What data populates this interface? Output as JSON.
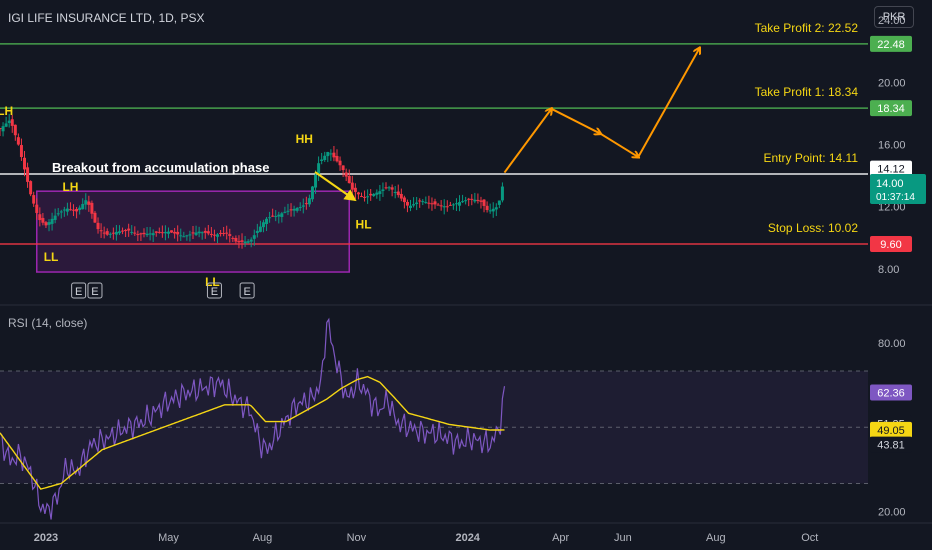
{
  "header": {
    "title": "IGI LIFE INSURANCE LTD, 1D, PSX",
    "currency": "PKR"
  },
  "price_axis": {
    "ticks": [
      "24.00",
      "20.00",
      "16.00",
      "12.00",
      "8.00"
    ],
    "tick_values": [
      24,
      20,
      16,
      12,
      8
    ],
    "tags": [
      {
        "label": "22.48",
        "value": 22.48,
        "color": "#4caf50"
      },
      {
        "label": "18.34",
        "value": 18.34,
        "color": "#4caf50"
      },
      {
        "label": "14.12",
        "value": 14.45,
        "color": "#ffffff",
        "text_color": "#131722"
      },
      {
        "label": "9.60",
        "value": 9.6,
        "color": "#f23645"
      }
    ],
    "last_price": {
      "price": "14.00",
      "countdown": "01:37:14",
      "color": "#089981"
    }
  },
  "levels": [
    {
      "label": "Take Profit 2: 22.52",
      "value": 22.48,
      "color": "#4caf50"
    },
    {
      "label": "Take Profit 1: 18.34",
      "value": 18.34,
      "color": "#4caf50"
    },
    {
      "label": "Entry Point: 14.11",
      "value": 14.11,
      "color": "#ffffff"
    },
    {
      "label": "Stop Loss: 10.02",
      "value": 9.6,
      "color": "#f23645"
    }
  ],
  "annotations": {
    "breakout": "Breakout from accumulation phase",
    "swing_labels": [
      {
        "text": "LH",
        "day": 5,
        "price": 17.9
      },
      {
        "text": "LH",
        "day": 69,
        "price": 13.0
      },
      {
        "text": "LL",
        "day": 50,
        "price": 8.5
      },
      {
        "text": "LL",
        "day": 208,
        "price": 6.9
      },
      {
        "text": "HH",
        "day": 298,
        "price": 16.1
      },
      {
        "text": "HL",
        "day": 356,
        "price": 10.6
      }
    ],
    "earnings_markers": [
      "E",
      "E",
      "E",
      "E"
    ],
    "earnings_days": [
      77,
      93,
      210,
      242
    ]
  },
  "rsi": {
    "title": "RSI (14, close)",
    "ticks": [
      "80.00",
      "20.00"
    ],
    "tick_values": [
      80,
      20
    ],
    "bands": [
      70,
      50,
      30
    ],
    "tags": [
      {
        "label": "62.36",
        "value": 62.36,
        "color": "#7e57c2",
        "text_color": "#ffffff"
      },
      {
        "label": "51.35",
        "value": 51.35,
        "color": "#131722",
        "text_color": "#d1d4dc"
      },
      {
        "label": "49.05",
        "value": 49.05,
        "color": "#f5d614",
        "text_color": "#131722"
      },
      {
        "label": "43.81",
        "value": 43.81,
        "color": "#131722",
        "text_color": "#d1d4dc"
      }
    ]
  },
  "time_axis": {
    "labels": [
      "2023",
      "May",
      "Aug",
      "Nov",
      "2024",
      "Apr",
      "Jun",
      "Aug",
      "Oct"
    ],
    "days": [
      45,
      165,
      257,
      349,
      458,
      549,
      610,
      701,
      793
    ]
  },
  "chart_data": {
    "type": "line",
    "title": "IGI LIFE INSURANCE LTD, 1D, PSX",
    "x_unit": "days since 2022-11-17",
    "series": [
      {
        "name": "Price",
        "x": [
          0,
          10,
          18,
          30,
          38,
          45,
          55,
          65,
          75,
          85,
          95,
          105,
          115,
          125,
          135,
          150,
          165,
          180,
          195,
          210,
          222,
          232,
          245,
          258,
          262,
          270,
          280,
          295,
          302,
          312,
          322,
          335,
          345,
          355,
          362,
          372,
          380,
          388,
          400,
          412,
          422,
          438,
          450,
          460,
          470,
          478,
          487,
          490,
          494
        ],
        "y": [
          17.0,
          17.6,
          16.0,
          12.8,
          11.2,
          10.8,
          11.5,
          11.9,
          11.7,
          12.5,
          10.6,
          10.2,
          10.4,
          10.5,
          10.2,
          10.3,
          10.4,
          10.1,
          10.4,
          10.2,
          10.3,
          9.7,
          9.8,
          11.0,
          11.3,
          11.4,
          11.7,
          12.0,
          12.3,
          14.8,
          15.6,
          14.5,
          13.1,
          12.6,
          12.7,
          13.0,
          13.3,
          12.9,
          12.0,
          12.4,
          12.2,
          12.0,
          12.3,
          12.5,
          12.4,
          11.7,
          12.0,
          12.6,
          14.0
        ]
      },
      {
        "name": "RSI",
        "x": [
          0,
          10,
          20,
          30,
          40,
          45,
          55,
          65,
          75,
          90,
          105,
          125,
          140,
          160,
          180,
          200,
          215,
          230,
          245,
          255,
          262,
          275,
          290,
          305,
          315,
          320,
          330,
          340,
          350,
          358,
          365,
          372,
          380,
          388,
          400,
          415,
          425,
          440,
          450,
          460,
          470,
          480,
          487,
          490,
          494
        ],
        "y": [
          46.0,
          38.0,
          40.0,
          34.0,
          22.0,
          20.0,
          24.0,
          36.0,
          34.0,
          44.0,
          46.0,
          50.0,
          52.0,
          58.0,
          62.0,
          64.0,
          66.0,
          60.0,
          56.0,
          44.0,
          42.0,
          50.0,
          58.0,
          60.0,
          66.0,
          88.0,
          72.0,
          60.0,
          66.0,
          63.0,
          58.0,
          56.0,
          60.0,
          52.0,
          50.0,
          48.0,
          48.0,
          46.0,
          44.0,
          46.0,
          45.0,
          44.0,
          48.0,
          52.0,
          62.36
        ]
      },
      {
        "name": "RSI-based MA",
        "x": [
          0,
          20,
          40,
          60,
          80,
          100,
          130,
          160,
          190,
          220,
          245,
          260,
          280,
          300,
          320,
          335,
          350,
          360,
          372,
          385,
          400,
          420,
          440,
          460,
          480,
          494
        ],
        "y": [
          48.0,
          38.0,
          28.0,
          30.0,
          36.0,
          42.0,
          46.0,
          50.0,
          54.0,
          58.0,
          58.0,
          52.0,
          52.0,
          56.0,
          60.0,
          64.0,
          67.0,
          68.0,
          66.0,
          61.0,
          55.0,
          53.0,
          51.0,
          50.0,
          49.0,
          49.05
        ]
      }
    ],
    "ylim_price": [
      6.0,
      25.3
    ],
    "ylim_rsi": [
      17.0,
      91.0
    ],
    "xlim": [
      0,
      850
    ]
  },
  "colors": {
    "background": "#131722",
    "bull": "#089981",
    "bear": "#f23645",
    "rsi_line": "#7e57c2",
    "rsi_ma": "#f5d614",
    "box": "#9c27b0",
    "arrow": "#ff9800",
    "label": "#f5d614"
  }
}
